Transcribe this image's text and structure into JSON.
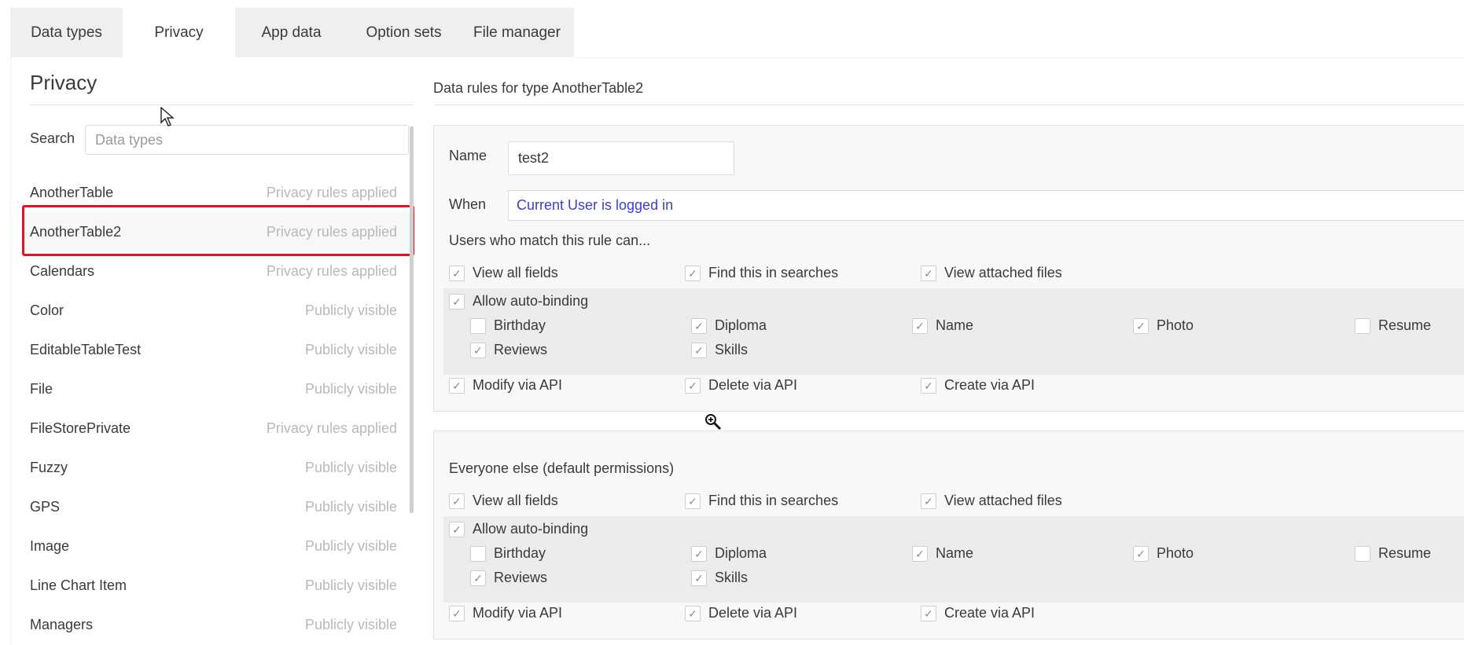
{
  "tabs": [
    {
      "label": "Data types",
      "active": false
    },
    {
      "label": "Privacy",
      "active": true
    },
    {
      "label": "App data",
      "active": false
    },
    {
      "label": "Option sets",
      "active": false
    },
    {
      "label": "File manager",
      "active": false
    }
  ],
  "left": {
    "title": "Privacy",
    "search_label": "Search",
    "search_placeholder": "Data types",
    "items": [
      {
        "name": "AnotherTable",
        "status": "Privacy rules applied"
      },
      {
        "name": "AnotherTable2",
        "status": "Privacy rules applied"
      },
      {
        "name": "Calendars",
        "status": "Privacy rules applied"
      },
      {
        "name": "Color",
        "status": "Publicly visible"
      },
      {
        "name": "EditableTableTest",
        "status": "Publicly visible"
      },
      {
        "name": "File",
        "status": "Publicly visible"
      },
      {
        "name": "FileStorePrivate",
        "status": "Privacy rules applied"
      },
      {
        "name": "Fuzzy",
        "status": "Publicly visible"
      },
      {
        "name": "GPS",
        "status": "Publicly visible"
      },
      {
        "name": "Image",
        "status": "Publicly visible"
      },
      {
        "name": "Line Chart Item",
        "status": "Publicly visible"
      },
      {
        "name": "Managers",
        "status": "Publicly visible"
      }
    ]
  },
  "right": {
    "header": "Data rules for type AnotherTable2",
    "rule": {
      "name_label": "Name",
      "name_value": "test2",
      "when_label": "When",
      "when_value": "Current User is logged in",
      "users_label": "Users who match this rule can...",
      "view_all_fields": "View all fields",
      "find_in_searches": "Find this in searches",
      "view_attached_files": "View attached files",
      "allow_auto_binding": "Allow auto-binding",
      "fields": {
        "birthday": "Birthday",
        "diploma": "Diploma",
        "name": "Name",
        "photo": "Photo",
        "resume": "Resume",
        "reviews": "Reviews",
        "skills": "Skills"
      },
      "modify_via_api": "Modify via API",
      "delete_via_api": "Delete via API",
      "create_via_api": "Create via API"
    },
    "default": {
      "label": "Everyone else (default permissions)",
      "view_all_fields": "View all fields",
      "find_in_searches": "Find this in searches",
      "view_attached_files": "View attached files",
      "allow_auto_binding": "Allow auto-binding",
      "fields": {
        "birthday": "Birthday",
        "diploma": "Diploma",
        "name": "Name",
        "photo": "Photo",
        "resume": "Resume",
        "reviews": "Reviews",
        "skills": "Skills"
      },
      "modify_via_api": "Modify via API",
      "delete_via_api": "Delete via API",
      "create_via_api": "Create via API"
    }
  },
  "colors": {
    "highlight": "#e8131d",
    "link": "#3c3fc8",
    "muted": "#b9b9b9"
  }
}
